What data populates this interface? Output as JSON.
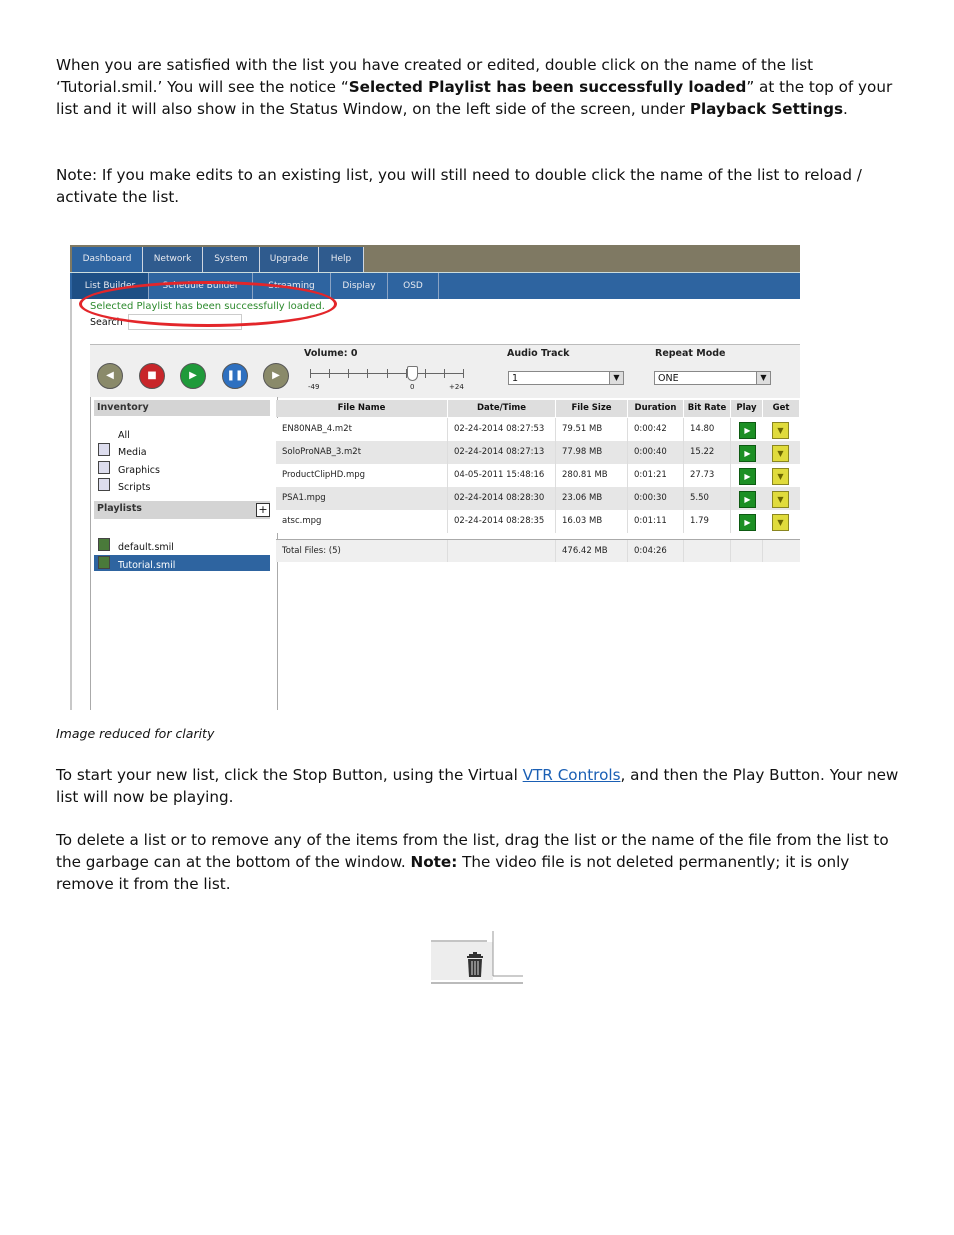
{
  "p1": {
    "t1": "When you are satisfied with the list you have created or edited, double click on the name of the list ‘Tutorial.smil.’ You will see the notice “",
    "b1": "Selected Playlist has been successfully loaded",
    "t2": "” at the top of your list and it will also show in the Status Window, on the left side of the screen, under ",
    "b2": "Playback Settings",
    "t3": "."
  },
  "p2": "Note: If you make edits to an existing list, you will still need to double click the name of the list to reload / activate the list.",
  "screenshot": {
    "top_tabs": [
      "Dashboard",
      "Network",
      "System",
      "Upgrade",
      "Help"
    ],
    "sub_tabs": [
      "List Builder",
      "Schedule Builder",
      "Streaming",
      "Display",
      "OSD"
    ],
    "notice": "Selected Playlist has been successfully loaded.",
    "search_label": "Search",
    "volume_label": "Volume: 0",
    "volume_min": "-49",
    "volume_mid": "0",
    "volume_max": "+24",
    "audio_track_label": "Audio Track",
    "audio_track_value": "1",
    "repeat_mode_label": "Repeat Mode",
    "repeat_mode_value": "ONE",
    "inventory_label": "Inventory",
    "inventory_items": [
      "All",
      "Media",
      "Graphics",
      "Scripts"
    ],
    "playlists_label": "Playlists",
    "playlists": [
      "default.smil",
      "Tutorial.smil"
    ],
    "columns": [
      "File Name",
      "Date/Time",
      "File Size",
      "Duration",
      "Bit Rate",
      "Play",
      "Get"
    ],
    "rows": [
      [
        "EN80NAB_4.m2t",
        "02-24-2014   08:27:53",
        "79.51 MB",
        "0:00:42",
        "14.80"
      ],
      [
        "SoloProNAB_3.m2t",
        "02-24-2014   08:27:13",
        "77.98 MB",
        "0:00:40",
        "15.22"
      ],
      [
        "ProductClipHD.mpg",
        "04-05-2011   15:48:16",
        "280.81 MB",
        "0:01:21",
        "27.73"
      ],
      [
        "PSA1.mpg",
        "02-24-2014   08:28:30",
        "23.06 MB",
        "0:00:30",
        "5.50"
      ],
      [
        "atsc.mpg",
        "02-24-2014   08:28:35",
        "16.03 MB",
        "0:01:11",
        "1.79"
      ]
    ],
    "total_label": "Total Files: (5)",
    "total_size": "476.42 MB",
    "total_duration": "0:04:26"
  },
  "caption": "Image reduced for clarity",
  "p3": {
    "t1": "To start your new list, click the Stop Button, using the Virtual ",
    "link": "VTR Controls",
    "t2": ", and then the Play Button. Your new list will now be playing."
  },
  "p4": {
    "t1": "To delete a list or to remove any of the items from the list, drag the list or the name of the file from the list to the garbage can at the bottom of the window. ",
    "b1": "Note:",
    "t2": " The video file is not deleted permanently; it is only remove it from the list."
  },
  "colors": {
    "nav_blue": "#2e64a0",
    "notice_green": "#2d8a2d",
    "highlight_red": "#e3262a",
    "link_blue": "#1a5fb4"
  }
}
